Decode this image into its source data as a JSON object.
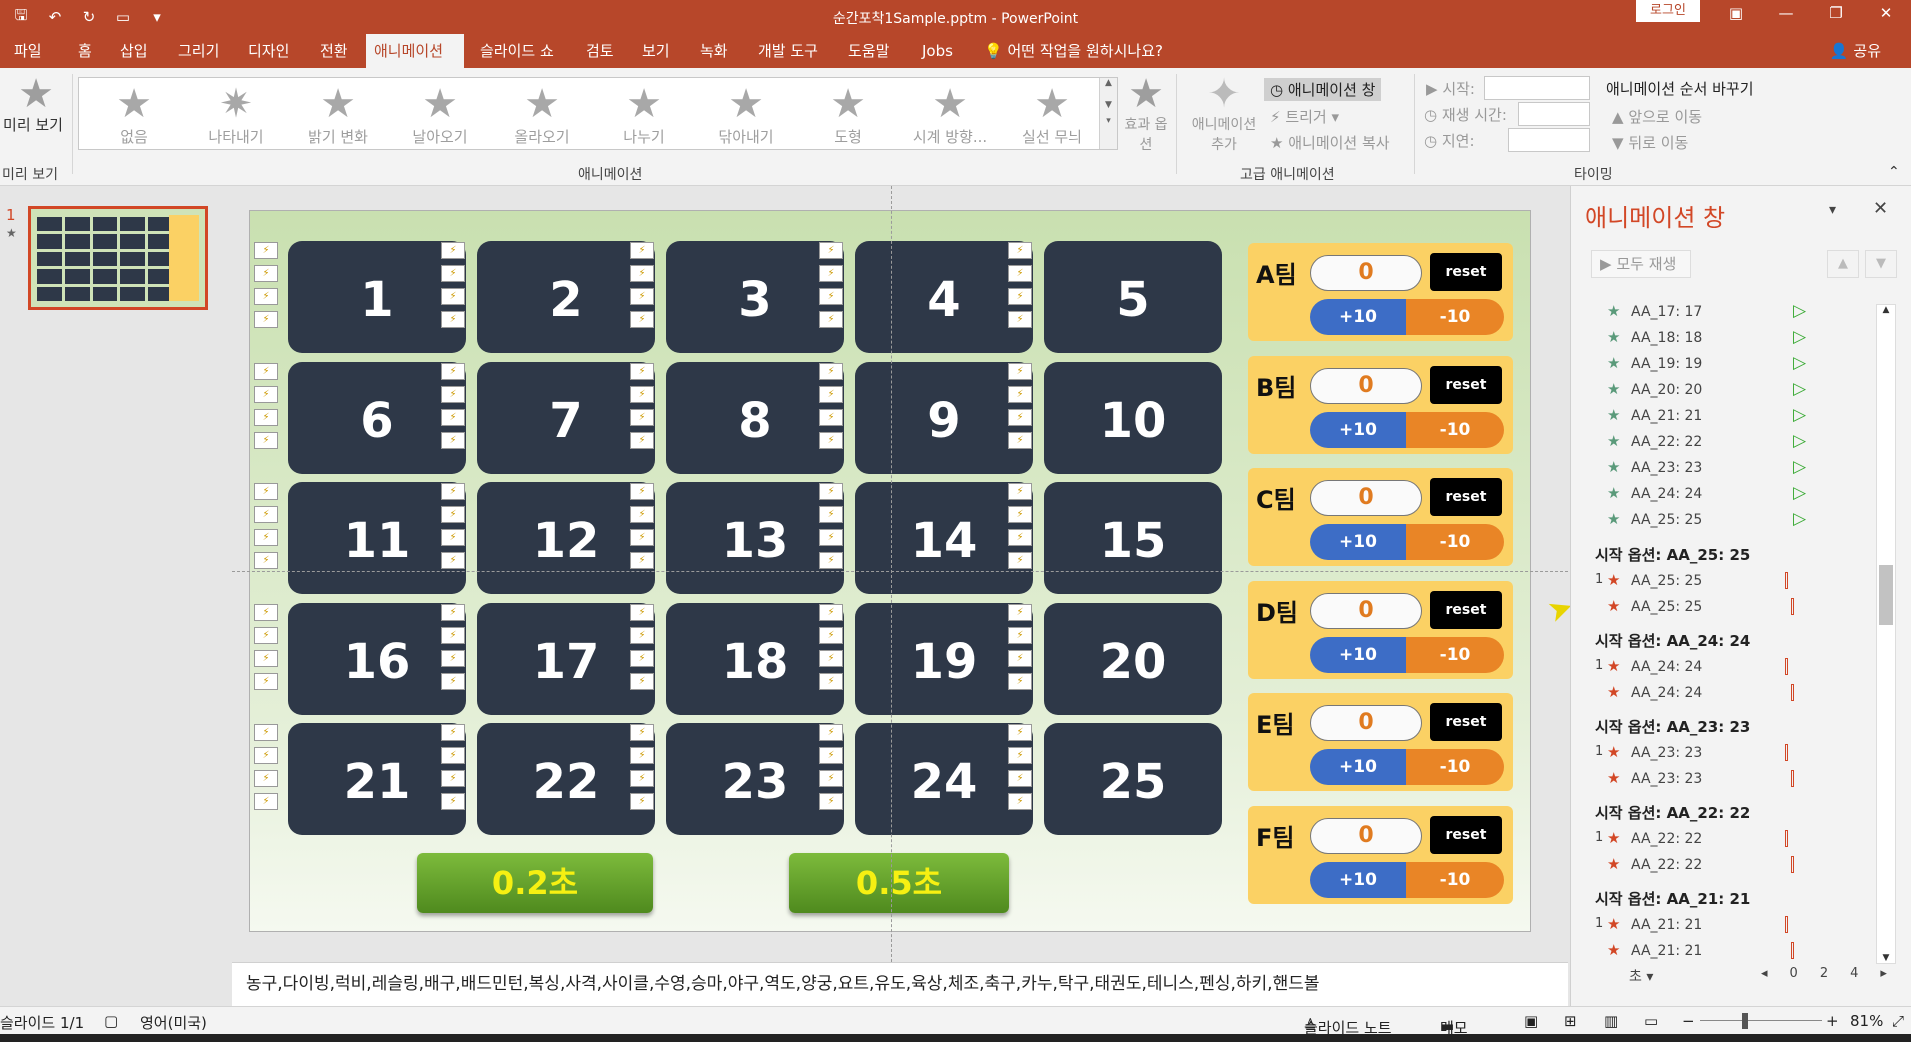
{
  "titlebar": {
    "document_title": "순간포착1Sample.pptm - PowerPoint",
    "login_label": "로그인"
  },
  "tabs": [
    "파일",
    "홈",
    "삽입",
    "그리기",
    "디자인",
    "전환",
    "애니메이션",
    "슬라이드 쇼",
    "검토",
    "보기",
    "녹화",
    "개발 도구",
    "도움말",
    "Jobs",
    "어떤 작업을 원하시나요?"
  ],
  "active_tab": "애니메이션",
  "share_label": "공유",
  "ribbon": {
    "preview_label": "미리 보기",
    "preview_group": "미리 보기",
    "animation_group": "애니메이션",
    "advanced_group": "고급 애니메이션",
    "timing_group": "타이밍",
    "gallery": [
      "없음",
      "나타내기",
      "밝기 변화",
      "날아오기",
      "올라오기",
      "나누기",
      "닦아내기",
      "도형",
      "시계 방향...",
      "실선 무늬"
    ],
    "effect_options": "효과 옵션",
    "add_animation": "애니메이션 추가",
    "animation_pane_btn": "애니메이션 창",
    "trigger": "트리거",
    "animation_painter": "애니메이션 복사",
    "start_label": "시작:",
    "duration_label": "재생 시간:",
    "delay_label": "지연:",
    "reorder_title": "애니메이션 순서 바꾸기",
    "move_earlier": "앞으로 이동",
    "move_later": "뒤로 이동"
  },
  "slide_thumb_number": "1",
  "cards": [
    "1",
    "2",
    "3",
    "4",
    "5",
    "6",
    "7",
    "8",
    "9",
    "10",
    "11",
    "12",
    "13",
    "14",
    "15",
    "16",
    "17",
    "18",
    "19",
    "20",
    "21",
    "22",
    "23",
    "24",
    "25"
  ],
  "teams": [
    {
      "name": "A팀",
      "score": "0",
      "reset": "reset",
      "plus": "+10",
      "minus": "-10"
    },
    {
      "name": "B팀",
      "score": "0",
      "reset": "reset",
      "plus": "+10",
      "minus": "-10"
    },
    {
      "name": "C팀",
      "score": "0",
      "reset": "reset",
      "plus": "+10",
      "minus": "-10"
    },
    {
      "name": "D팀",
      "score": "0",
      "reset": "reset",
      "plus": "+10",
      "minus": "-10"
    },
    {
      "name": "E팀",
      "score": "0",
      "reset": "reset",
      "plus": "+10",
      "minus": "-10"
    },
    {
      "name": "F팀",
      "score": "0",
      "reset": "reset",
      "plus": "+10",
      "minus": "-10"
    }
  ],
  "speed_buttons": [
    "0.2초",
    "0.5초"
  ],
  "notes_text": "농구,다이빙,럭비,레슬링,배구,배드민턴,복싱,사격,사이클,수영,승마,야구,역도,양궁,요트,유도,육상,체조,축구,카누,탁구,태권도,테니스,펜싱,하키,핸드볼",
  "animation_pane": {
    "title": "애니메이션 창",
    "play_all": "모두 재생",
    "items": [
      "AA_17: 17",
      "AA_18: 18",
      "AA_19: 19",
      "AA_20: 20",
      "AA_21: 21",
      "AA_22: 22",
      "AA_23: 23",
      "AA_24: 24",
      "AA_25: 25"
    ],
    "groups": [
      {
        "header": "시작 옵션: AA_25: 25",
        "first": "AA_25: 25",
        "second": "AA_25: 25"
      },
      {
        "header": "시작 옵션: AA_24: 24",
        "first": "AA_24: 24",
        "second": "AA_24: 24"
      },
      {
        "header": "시작 옵션: AA_23: 23",
        "first": "AA_23: 23",
        "second": "AA_23: 23"
      },
      {
        "header": "시작 옵션: AA_22: 22",
        "first": "AA_22: 22",
        "second": "AA_22: 22"
      },
      {
        "header": "시작 옵션: AA_21: 21",
        "first": "AA_21: 21",
        "second": "AA_21: 21"
      }
    ],
    "group_num": "1",
    "seconds_label": "초",
    "timeline": [
      "0",
      "2",
      "4"
    ]
  },
  "statusbar": {
    "slide": "슬라이드 1/1",
    "language": "영어(미국)",
    "notes": "슬라이드 노트",
    "comments": "메모",
    "zoom": "81%"
  }
}
